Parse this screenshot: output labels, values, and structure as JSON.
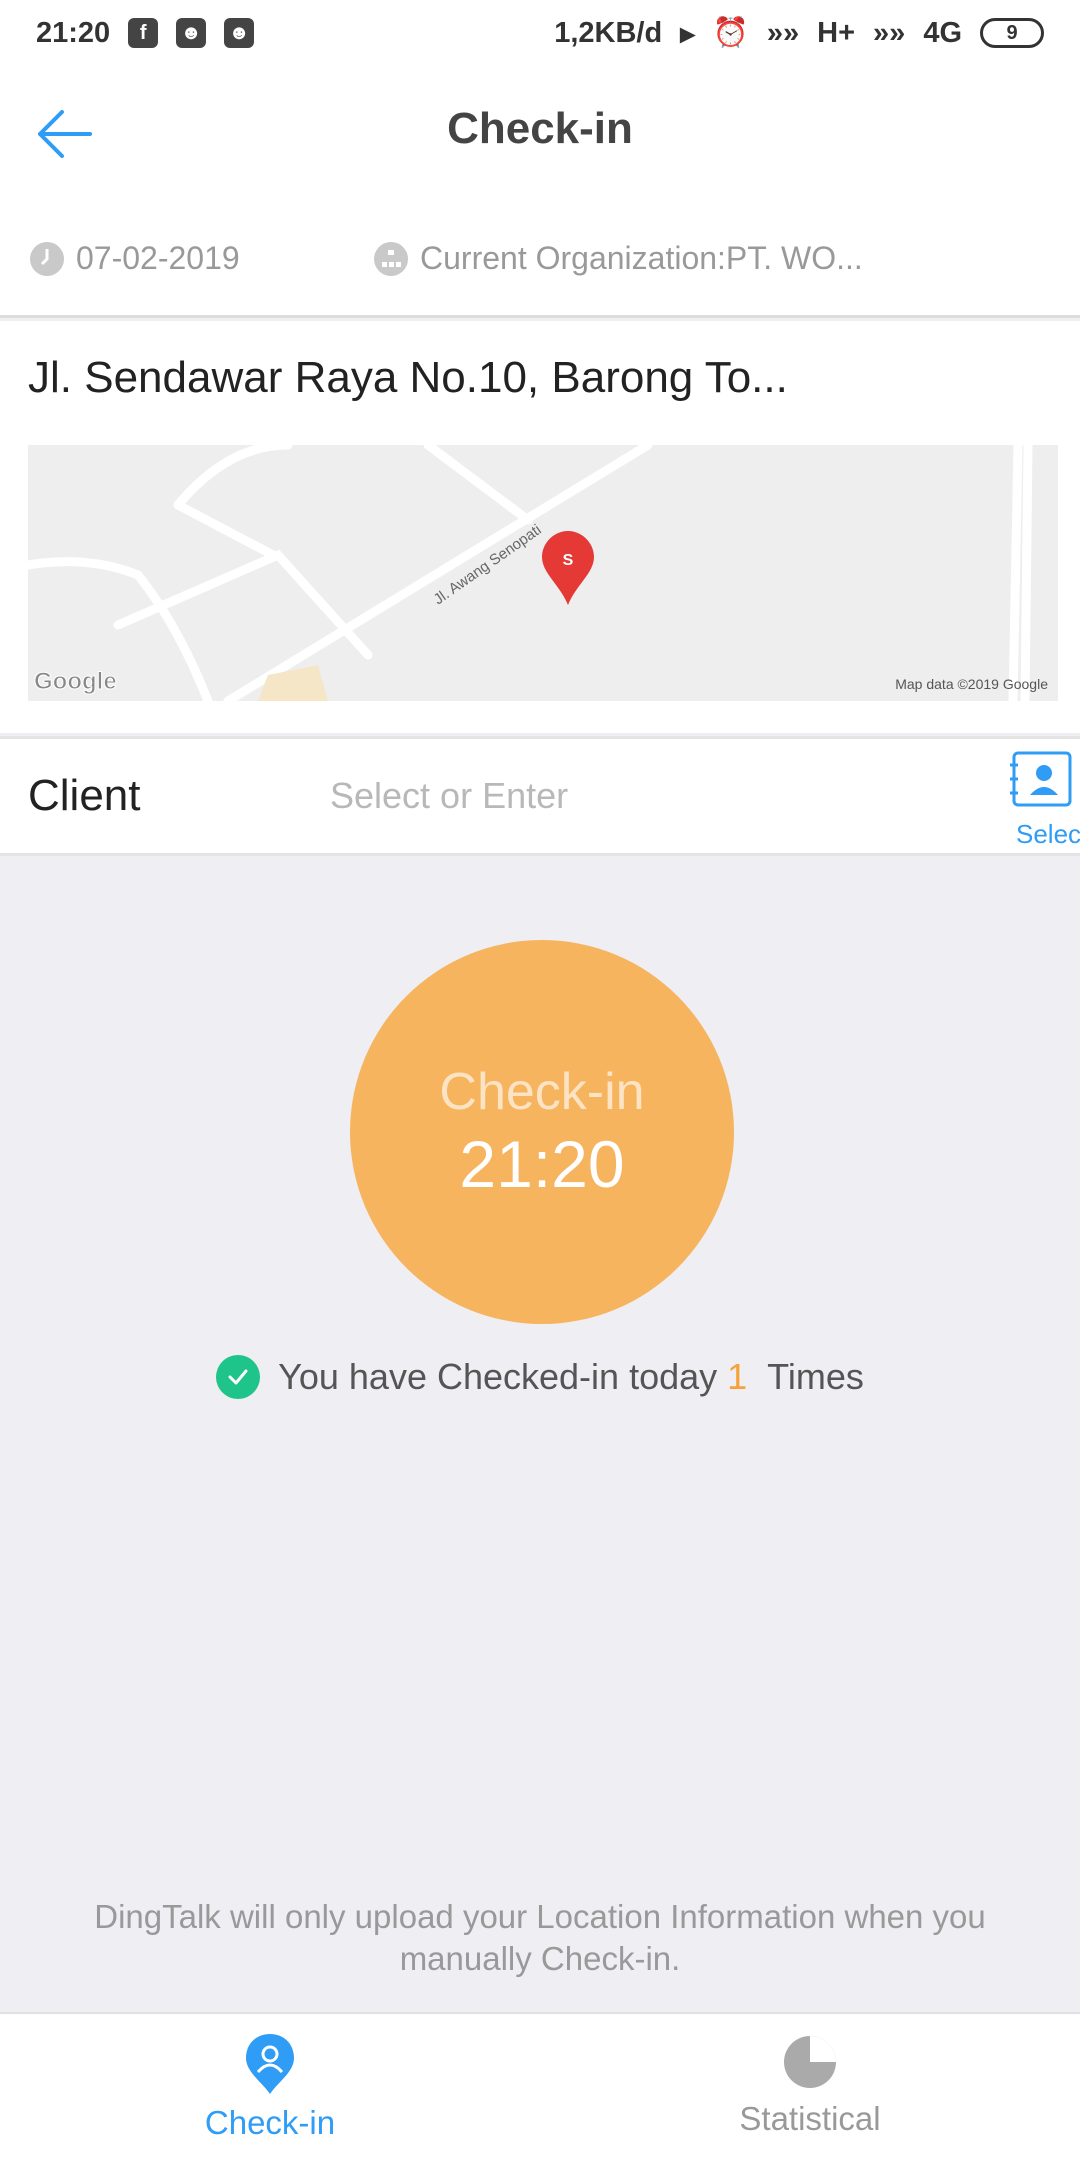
{
  "status_bar": {
    "time": "21:20",
    "net_speed": "1,2KB/d",
    "network1": "H+",
    "network2": "4G",
    "battery": "9"
  },
  "header": {
    "title": "Check-in"
  },
  "info": {
    "date": "07-02-2019",
    "organization": "Current Organization:PT. WO..."
  },
  "location": {
    "address": "Jl. Sendawar Raya No.10, Barong To...",
    "map_road_label": "Jl. Awang Senopati",
    "map_pin_letter": "S",
    "map_attribution": "Map data ©2019 Google",
    "map_logo": "Google"
  },
  "client": {
    "label": "Client",
    "placeholder": "Select or Enter",
    "select_label": "Select"
  },
  "checkin_button": {
    "label": "Check-in",
    "time": "21:20"
  },
  "status": {
    "prefix": "You have Checked-in today",
    "count": "1",
    "suffix": "Times"
  },
  "footnote": "DingTalk will only upload your Location Information when you manually Check-in.",
  "tabs": [
    {
      "label": "Check-in",
      "active": true
    },
    {
      "label": "Statistical",
      "active": false
    }
  ],
  "colors": {
    "accent": "#2f9cf5",
    "checkin_orange": "#f6b45f",
    "count_orange": "#f6a13b",
    "success_green": "#1ec48a"
  }
}
